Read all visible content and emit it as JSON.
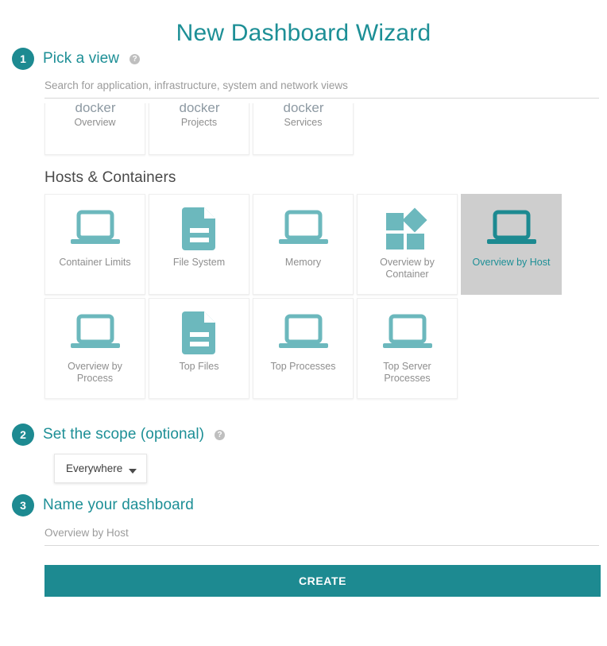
{
  "page": {
    "title": "New Dashboard Wizard",
    "accent_color": "#1d8f96",
    "selected_tile_bg": "#cecece"
  },
  "steps": {
    "pick_view": {
      "number": "1",
      "title": "Pick a view",
      "help": "?"
    },
    "scope": {
      "number": "2",
      "title": "Set the scope (optional)",
      "help": "?"
    },
    "name": {
      "number": "3",
      "title": "Name your dashboard"
    }
  },
  "search": {
    "value": "",
    "placeholder": "Search for application, infrastructure, system and network views"
  },
  "view_groups": [
    {
      "name": "",
      "tiles": [
        {
          "label": "Overview",
          "icon": "docker-logo-icon",
          "selected": false
        },
        {
          "label": "Projects",
          "icon": "docker-logo-icon",
          "selected": false
        },
        {
          "label": "Services",
          "icon": "docker-logo-icon",
          "selected": false
        }
      ]
    },
    {
      "name": "Hosts & Containers",
      "tiles": [
        {
          "label": "Container Limits",
          "icon": "laptop-icon",
          "selected": false
        },
        {
          "label": "File System",
          "icon": "file-icon",
          "selected": false
        },
        {
          "label": "Memory",
          "icon": "laptop-icon",
          "selected": false
        },
        {
          "label": "Overview by Container",
          "icon": "grid-diamond-icon",
          "selected": false
        },
        {
          "label": "Overview by Host",
          "icon": "laptop-icon",
          "selected": true
        },
        {
          "label": "Overview by Process",
          "icon": "laptop-icon",
          "selected": false
        },
        {
          "label": "Top Files",
          "icon": "file-icon",
          "selected": false
        },
        {
          "label": "Top Processes",
          "icon": "laptop-icon",
          "selected": false
        },
        {
          "label": "Top Server Processes",
          "icon": "laptop-icon",
          "selected": false
        }
      ]
    }
  ],
  "scope": {
    "selected": "Everywhere"
  },
  "dashboard_name": {
    "value": "",
    "placeholder": "Overview by Host"
  },
  "create": {
    "label": "CREATE"
  }
}
